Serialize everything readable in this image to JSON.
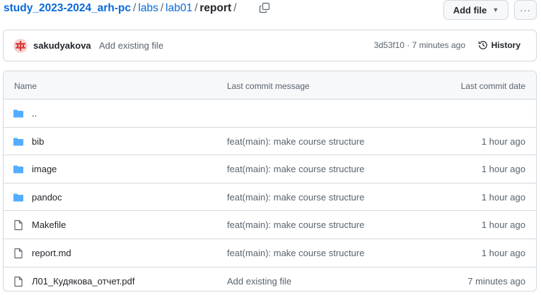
{
  "breadcrumb": {
    "repo": "study_2023-2024_arh-pc",
    "sep": "/",
    "parts": [
      "labs",
      "lab01"
    ],
    "current": "report"
  },
  "toolbar": {
    "add_file_label": "Add file",
    "more_label": "···"
  },
  "latest_commit": {
    "author": "sakudyakova",
    "message": "Add existing file",
    "meta": "3d53f10 · 7 minutes ago",
    "history_label": "History"
  },
  "table": {
    "columns": [
      "Name",
      "Last commit message",
      "Last commit date"
    ],
    "rows": [
      {
        "type": "folder",
        "name": "..",
        "message": "",
        "date": ""
      },
      {
        "type": "folder",
        "name": "bib",
        "message": "feat(main): make course structure",
        "date": "1 hour ago"
      },
      {
        "type": "folder",
        "name": "image",
        "message": "feat(main): make course structure",
        "date": "1 hour ago"
      },
      {
        "type": "folder",
        "name": "pandoc",
        "message": "feat(main): make course structure",
        "date": "1 hour ago"
      },
      {
        "type": "file",
        "name": "Makefile",
        "message": "feat(main): make course structure",
        "date": "1 hour ago"
      },
      {
        "type": "file",
        "name": "report.md",
        "message": "feat(main): make course structure",
        "date": "1 hour ago"
      },
      {
        "type": "file",
        "name": "Л01_Кудякова_отчет.pdf",
        "message": "Add existing file",
        "date": "7 minutes ago"
      }
    ]
  },
  "colors": {
    "link": "#0969da",
    "folder": "#54aeff",
    "muted": "#59636e",
    "border": "#d1d9e0"
  }
}
